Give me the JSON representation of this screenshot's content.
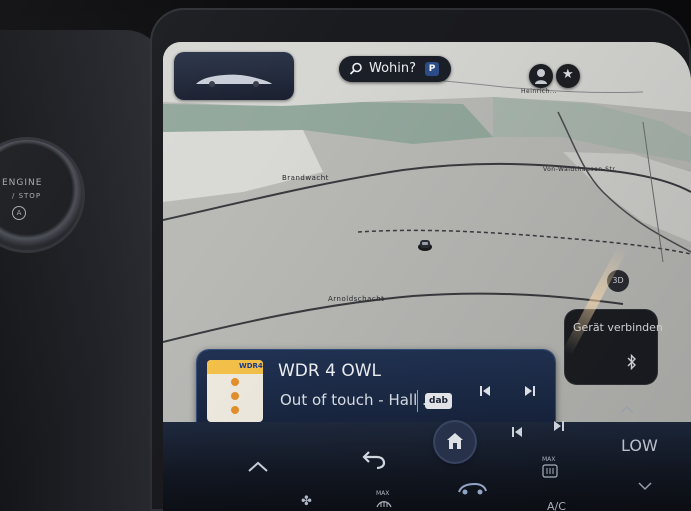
{
  "hardware": {
    "engine_button_line1": "ENGINE",
    "engine_button_line2": "/ STOP"
  },
  "navigation": {
    "search_placeholder": "Wohin?",
    "parking_badge": "P",
    "view_mode_label": "3D",
    "map_labels": {
      "place_1": "Brandwacht",
      "place_2": "Arnoldschacht",
      "place_3": "Heinrich...",
      "road_1": "Von-Waldthausen-Str."
    }
  },
  "media": {
    "station": "WDR 4 OWL",
    "track": "Out of touch - Hall ...",
    "source_badge": "dab",
    "logo_text": "WDR4"
  },
  "connect_device": {
    "label": "Gerät verbinden"
  },
  "climate": {
    "temperature_label": "LOW",
    "ac_label": "A/C",
    "max_front_label": "MAX",
    "max_rear_label": "MAX"
  },
  "colors": {
    "map_land": "#b9b9b6",
    "map_green": "#93a89c",
    "map_light": "#d6d6d3",
    "card_blue": "#1c2b48",
    "accent_blue": "#35507e"
  }
}
